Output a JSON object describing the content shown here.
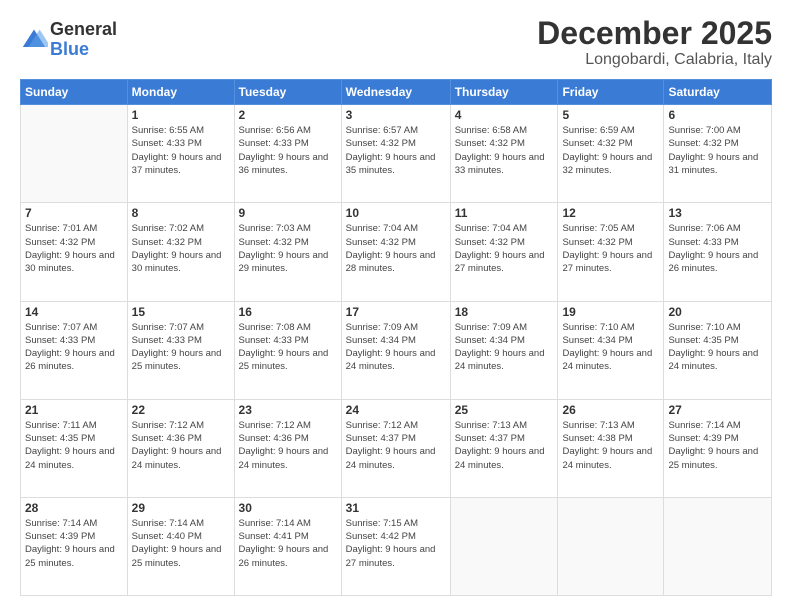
{
  "logo": {
    "general": "General",
    "blue": "Blue"
  },
  "header": {
    "month": "December 2025",
    "location": "Longobardi, Calabria, Italy"
  },
  "weekdays": [
    "Sunday",
    "Monday",
    "Tuesday",
    "Wednesday",
    "Thursday",
    "Friday",
    "Saturday"
  ],
  "weeks": [
    [
      {
        "day": "",
        "empty": true
      },
      {
        "day": "1",
        "sunrise": "6:55 AM",
        "sunset": "4:33 PM",
        "daylight": "9 hours and 37 minutes."
      },
      {
        "day": "2",
        "sunrise": "6:56 AM",
        "sunset": "4:33 PM",
        "daylight": "9 hours and 36 minutes."
      },
      {
        "day": "3",
        "sunrise": "6:57 AM",
        "sunset": "4:32 PM",
        "daylight": "9 hours and 35 minutes."
      },
      {
        "day": "4",
        "sunrise": "6:58 AM",
        "sunset": "4:32 PM",
        "daylight": "9 hours and 33 minutes."
      },
      {
        "day": "5",
        "sunrise": "6:59 AM",
        "sunset": "4:32 PM",
        "daylight": "9 hours and 32 minutes."
      },
      {
        "day": "6",
        "sunrise": "7:00 AM",
        "sunset": "4:32 PM",
        "daylight": "9 hours and 31 minutes."
      }
    ],
    [
      {
        "day": "7",
        "sunrise": "7:01 AM",
        "sunset": "4:32 PM",
        "daylight": "9 hours and 30 minutes."
      },
      {
        "day": "8",
        "sunrise": "7:02 AM",
        "sunset": "4:32 PM",
        "daylight": "9 hours and 30 minutes."
      },
      {
        "day": "9",
        "sunrise": "7:03 AM",
        "sunset": "4:32 PM",
        "daylight": "9 hours and 29 minutes."
      },
      {
        "day": "10",
        "sunrise": "7:04 AM",
        "sunset": "4:32 PM",
        "daylight": "9 hours and 28 minutes."
      },
      {
        "day": "11",
        "sunrise": "7:04 AM",
        "sunset": "4:32 PM",
        "daylight": "9 hours and 27 minutes."
      },
      {
        "day": "12",
        "sunrise": "7:05 AM",
        "sunset": "4:32 PM",
        "daylight": "9 hours and 27 minutes."
      },
      {
        "day": "13",
        "sunrise": "7:06 AM",
        "sunset": "4:33 PM",
        "daylight": "9 hours and 26 minutes."
      }
    ],
    [
      {
        "day": "14",
        "sunrise": "7:07 AM",
        "sunset": "4:33 PM",
        "daylight": "9 hours and 26 minutes."
      },
      {
        "day": "15",
        "sunrise": "7:07 AM",
        "sunset": "4:33 PM",
        "daylight": "9 hours and 25 minutes."
      },
      {
        "day": "16",
        "sunrise": "7:08 AM",
        "sunset": "4:33 PM",
        "daylight": "9 hours and 25 minutes."
      },
      {
        "day": "17",
        "sunrise": "7:09 AM",
        "sunset": "4:34 PM",
        "daylight": "9 hours and 24 minutes."
      },
      {
        "day": "18",
        "sunrise": "7:09 AM",
        "sunset": "4:34 PM",
        "daylight": "9 hours and 24 minutes."
      },
      {
        "day": "19",
        "sunrise": "7:10 AM",
        "sunset": "4:34 PM",
        "daylight": "9 hours and 24 minutes."
      },
      {
        "day": "20",
        "sunrise": "7:10 AM",
        "sunset": "4:35 PM",
        "daylight": "9 hours and 24 minutes."
      }
    ],
    [
      {
        "day": "21",
        "sunrise": "7:11 AM",
        "sunset": "4:35 PM",
        "daylight": "9 hours and 24 minutes."
      },
      {
        "day": "22",
        "sunrise": "7:12 AM",
        "sunset": "4:36 PM",
        "daylight": "9 hours and 24 minutes."
      },
      {
        "day": "23",
        "sunrise": "7:12 AM",
        "sunset": "4:36 PM",
        "daylight": "9 hours and 24 minutes."
      },
      {
        "day": "24",
        "sunrise": "7:12 AM",
        "sunset": "4:37 PM",
        "daylight": "9 hours and 24 minutes."
      },
      {
        "day": "25",
        "sunrise": "7:13 AM",
        "sunset": "4:37 PM",
        "daylight": "9 hours and 24 minutes."
      },
      {
        "day": "26",
        "sunrise": "7:13 AM",
        "sunset": "4:38 PM",
        "daylight": "9 hours and 24 minutes."
      },
      {
        "day": "27",
        "sunrise": "7:14 AM",
        "sunset": "4:39 PM",
        "daylight": "9 hours and 25 minutes."
      }
    ],
    [
      {
        "day": "28",
        "sunrise": "7:14 AM",
        "sunset": "4:39 PM",
        "daylight": "9 hours and 25 minutes."
      },
      {
        "day": "29",
        "sunrise": "7:14 AM",
        "sunset": "4:40 PM",
        "daylight": "9 hours and 25 minutes."
      },
      {
        "day": "30",
        "sunrise": "7:14 AM",
        "sunset": "4:41 PM",
        "daylight": "9 hours and 26 minutes."
      },
      {
        "day": "31",
        "sunrise": "7:15 AM",
        "sunset": "4:42 PM",
        "daylight": "9 hours and 27 minutes."
      },
      {
        "day": "",
        "empty": true
      },
      {
        "day": "",
        "empty": true
      },
      {
        "day": "",
        "empty": true
      }
    ]
  ]
}
